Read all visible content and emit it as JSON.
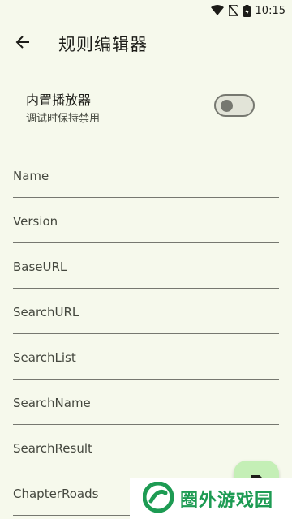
{
  "status": {
    "time": "10:15"
  },
  "appbar": {
    "title": "规则编辑器"
  },
  "player_switch": {
    "title": "内置播放器",
    "subtitle": "调试时保持禁用",
    "enabled": false
  },
  "fields": [
    {
      "label": "Name"
    },
    {
      "label": "Version"
    },
    {
      "label": "BaseURL"
    },
    {
      "label": "SearchURL"
    },
    {
      "label": "SearchList"
    },
    {
      "label": "SearchName"
    },
    {
      "label": "SearchResult"
    },
    {
      "label": "ChapterRoads"
    }
  ],
  "watermark": {
    "text": "圈外游戏园"
  },
  "colors": {
    "background": "#f6f9ec",
    "fab": "#c4efb6",
    "watermark_green": "#1d9b53"
  }
}
